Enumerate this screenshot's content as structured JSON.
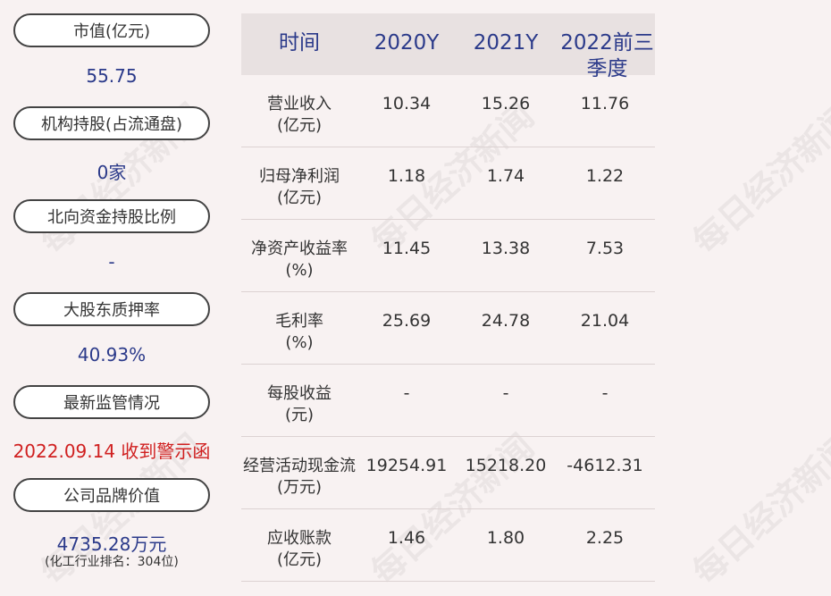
{
  "left": {
    "items": [
      {
        "label": "市值(亿元)",
        "value": "55.75"
      },
      {
        "label": "机构持股(占流通盘)",
        "value": "0家"
      },
      {
        "label": "北向资金持股比例",
        "value": "-"
      },
      {
        "label": "大股东质押率",
        "value": "40.93%"
      },
      {
        "label": "最新监管情况",
        "value": "2022.09.14 收到警示函"
      },
      {
        "label": "公司品牌价值",
        "value": "4735.28万元",
        "sub": "(化工行业排名：304位)"
      }
    ]
  },
  "table": {
    "headers": [
      "时间",
      "2020Y",
      "2021Y",
      "2022前三季度"
    ],
    "rows": [
      {
        "label1": "营业收入",
        "label2": "(亿元)",
        "v": [
          "10.34",
          "15.26",
          "11.76"
        ]
      },
      {
        "label1": "归母净利润",
        "label2": "(亿元)",
        "v": [
          "1.18",
          "1.74",
          "1.22"
        ]
      },
      {
        "label1": "净资产收益率",
        "label2": "(%)",
        "v": [
          "11.45",
          "13.38",
          "7.53"
        ]
      },
      {
        "label1": "毛利率",
        "label2": "(%)",
        "v": [
          "25.69",
          "24.78",
          "21.04"
        ]
      },
      {
        "label1": "每股收益",
        "label2": "(元)",
        "v": [
          "-",
          "-",
          "-"
        ]
      },
      {
        "label1": "经营活动现金流",
        "label2": "(万元)",
        "v": [
          "19254.91",
          "15218.20",
          "-4612.31"
        ]
      },
      {
        "label1": "应收账款",
        "label2": "(亿元)",
        "v": [
          "1.46",
          "1.80",
          "2.25"
        ]
      }
    ]
  },
  "watermark": "每日经济新闻"
}
